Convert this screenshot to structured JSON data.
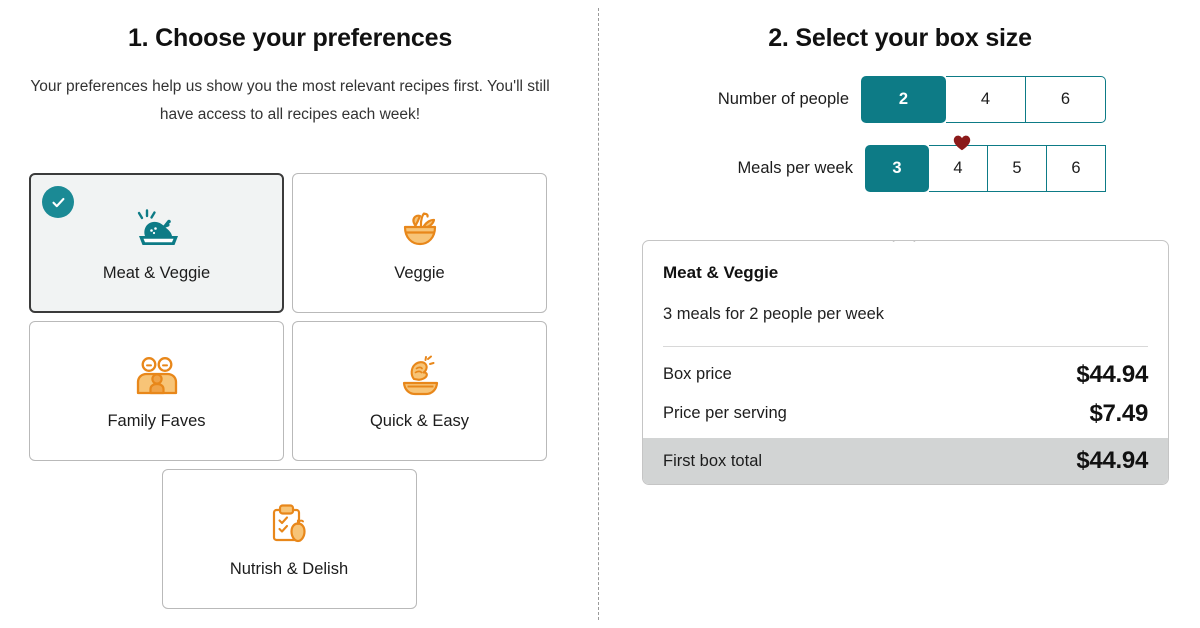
{
  "colors": {
    "teal": "#0d7b86",
    "teal_badge": "#1b8a95",
    "orange": "#e8871a",
    "orange_fill": "#f7c477",
    "heart_red": "#8b1a1a",
    "total_band": "#d2d4d4"
  },
  "left": {
    "title": "1. Choose your preferences",
    "intro": "Your preferences help us show you the most relevant recipes first. You'll still have access to all recipes each week!",
    "cards": [
      {
        "label": "Meat & Veggie",
        "icon": "roast-chicken-icon",
        "selected": true
      },
      {
        "label": "Veggie",
        "icon": "veggie-bowl-icon",
        "selected": false
      },
      {
        "label": "Family Faves",
        "icon": "family-icon",
        "selected": false
      },
      {
        "label": "Quick & Easy",
        "icon": "hand-over-bowl-icon",
        "selected": false
      },
      {
        "label": "Nutrish & Delish",
        "icon": "clipboard-apple-icon",
        "selected": false
      }
    ]
  },
  "right": {
    "title": "2. Select your box size",
    "people": {
      "label": "Number of people",
      "options": [
        "2",
        "4",
        "6"
      ],
      "selected": "2"
    },
    "meals": {
      "label": "Meals per week",
      "options": [
        "3",
        "4",
        "5",
        "6"
      ],
      "selected": "3",
      "favorite_marker_option": "4",
      "favorite_marker_icon": "heart-icon"
    },
    "summary": {
      "title": "Meat & Veggie",
      "subtitle": "3 meals for 2 people per week",
      "rows": [
        {
          "label": "Box price",
          "value": "$44.94",
          "highlight": false
        },
        {
          "label": "Price per serving",
          "value": "$7.49",
          "highlight": false
        },
        {
          "label": "First box total",
          "value": "$44.94",
          "highlight": true
        }
      ]
    }
  }
}
